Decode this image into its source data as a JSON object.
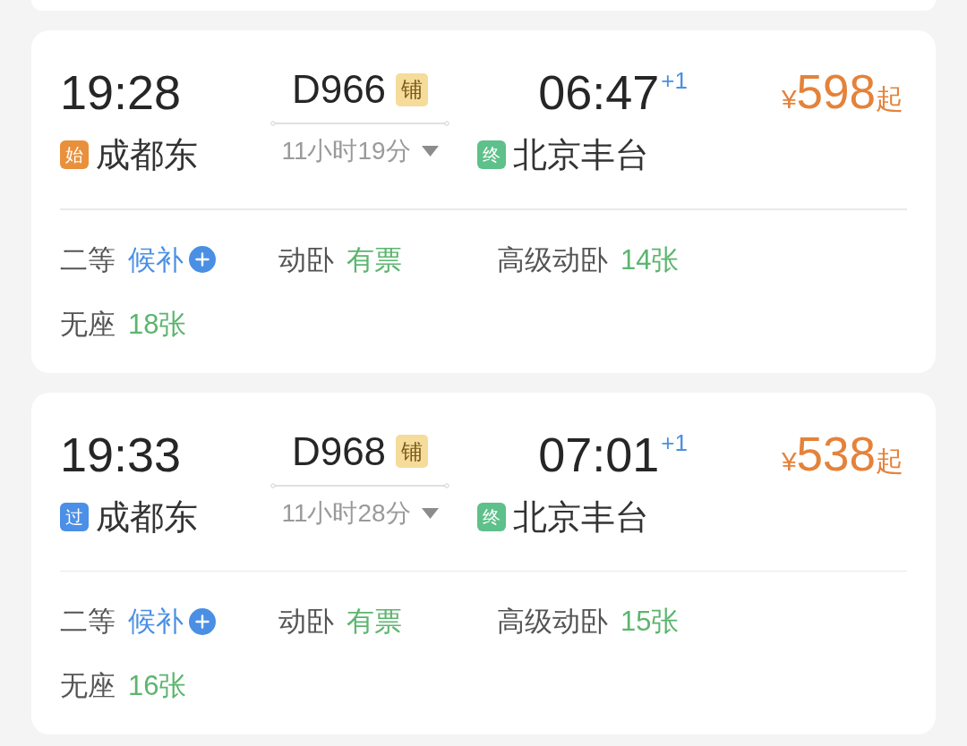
{
  "cards": [
    {
      "departure": {
        "time": "19:28",
        "station": "成都东",
        "tag": {
          "text": "始",
          "color": "#e9903c"
        }
      },
      "train": {
        "number": "D966",
        "tag": "铺",
        "duration": "11小时19分"
      },
      "arrival": {
        "time": "06:47",
        "day_offset": "+1",
        "station": "北京丰台",
        "tag": {
          "text": "终",
          "color": "#5ec08a"
        }
      },
      "price": {
        "currency": "¥",
        "amount": "598",
        "suffix": "起"
      },
      "seats": [
        {
          "class": "二等",
          "availability": "候补",
          "kind": "waitlist"
        },
        {
          "class": "动卧",
          "availability": "有票",
          "kind": "available"
        },
        {
          "class": "高级动卧",
          "availability": "14张",
          "kind": "available"
        },
        {
          "class": "无座",
          "availability": "18张",
          "kind": "available"
        }
      ]
    },
    {
      "departure": {
        "time": "19:33",
        "station": "成都东",
        "tag": {
          "text": "过",
          "color": "#4b8fe6"
        }
      },
      "train": {
        "number": "D968",
        "tag": "铺",
        "duration": "11小时28分"
      },
      "arrival": {
        "time": "07:01",
        "day_offset": "+1",
        "station": "北京丰台",
        "tag": {
          "text": "终",
          "color": "#5ec08a"
        }
      },
      "price": {
        "currency": "¥",
        "amount": "538",
        "suffix": "起"
      },
      "seats": [
        {
          "class": "二等",
          "availability": "候补",
          "kind": "waitlist"
        },
        {
          "class": "动卧",
          "availability": "有票",
          "kind": "available"
        },
        {
          "class": "高级动卧",
          "availability": "15张",
          "kind": "available"
        },
        {
          "class": "无座",
          "availability": "16张",
          "kind": "available"
        }
      ]
    }
  ]
}
